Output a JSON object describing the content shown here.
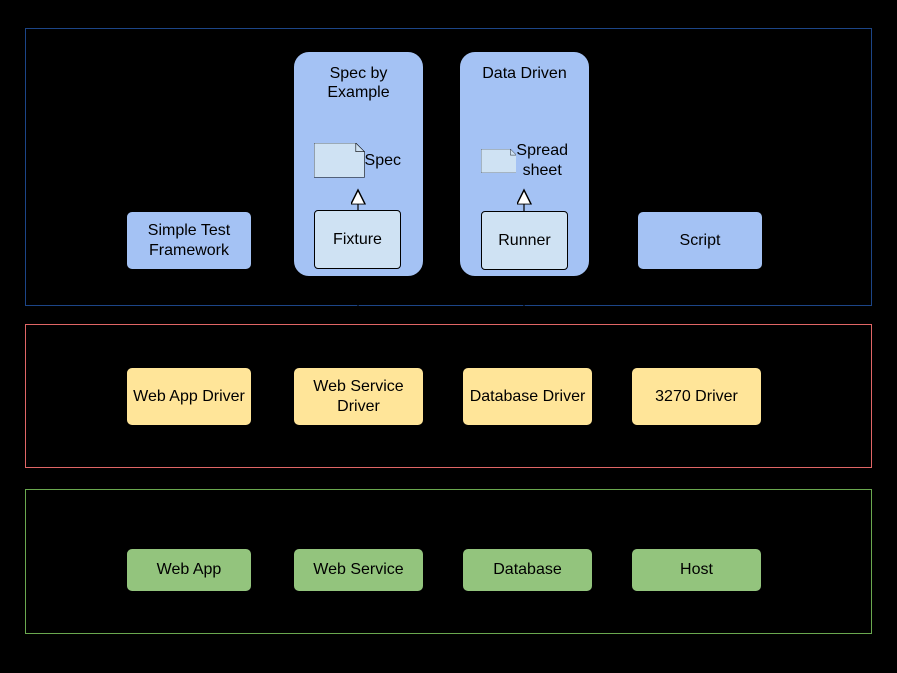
{
  "layers": {
    "tests": {
      "simple_test_framework": "Simple Test Framework",
      "spec_by_example": {
        "title": "Spec by Example",
        "spec": "Spec",
        "fixture": "Fixture"
      },
      "data_driven": {
        "title": "Data Driven",
        "spreadsheet": "Spread sheet",
        "runner": "Runner"
      },
      "script": "Script"
    },
    "drivers": {
      "web_app_driver": "Web App Driver",
      "web_service_driver": "Web Service Driver",
      "database_driver": "Database Driver",
      "driver_3270": "3270 Driver"
    },
    "systems": {
      "web_app": "Web App",
      "web_service": "Web Service",
      "database": "Database",
      "host": "Host"
    }
  },
  "colors": {
    "tests_border": "#1c4587",
    "drivers_border": "#e06666",
    "systems_border": "#6aa84f",
    "blue_light": "#a4c2f4",
    "blue_lighter": "#cfe2f3",
    "yellow": "#ffe599",
    "green": "#93c47d"
  }
}
